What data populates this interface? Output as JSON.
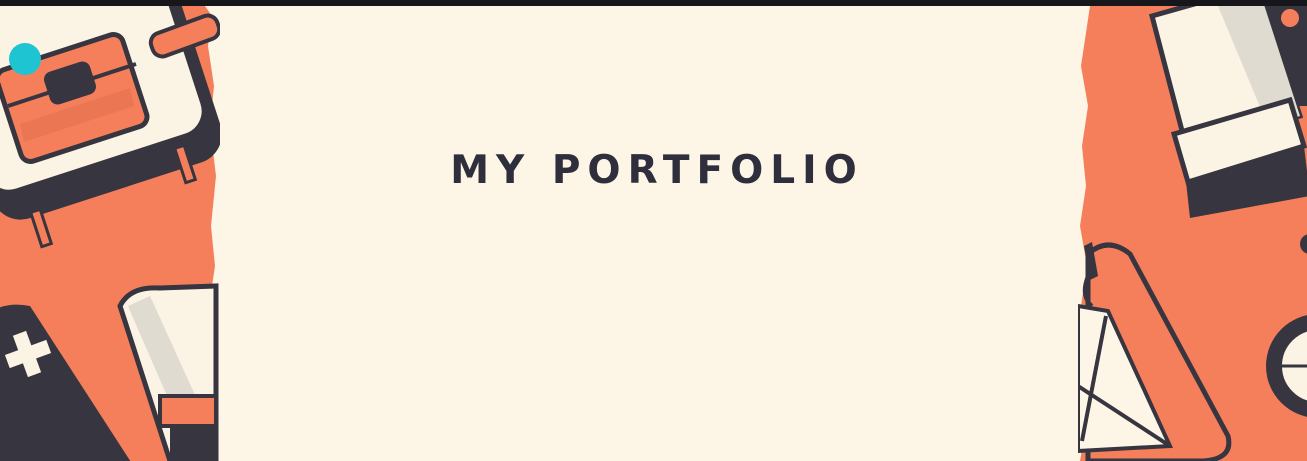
{
  "header": {
    "title": "MY PORTFOLIO"
  },
  "colors": {
    "background": "#fdf6e7",
    "text": "#2f2e3c",
    "accent": "#f57f5b",
    "dark": "#37353f",
    "cream": "#fbf3e3",
    "shade": "#e0dbd0",
    "highlight": "#1fc4d3",
    "topbar": "#17171b"
  },
  "decorations": {
    "left": [
      "toolbox-icon",
      "tablet-icon",
      "battery-icon"
    ],
    "right": [
      "jar-icon",
      "bag-icon",
      "wheel-icon"
    ]
  }
}
